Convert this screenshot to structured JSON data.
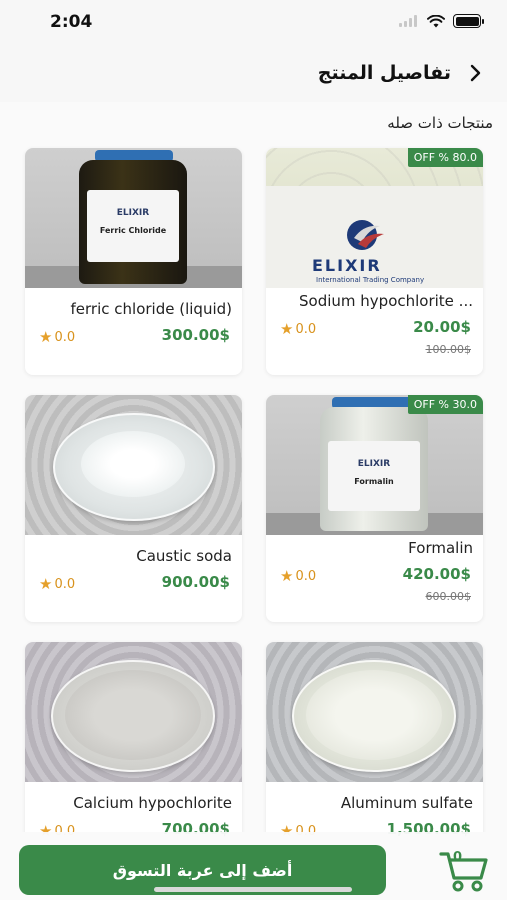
{
  "status_bar": {
    "time": "2:04"
  },
  "header": {
    "title": "تفاصيل المنتج"
  },
  "section": {
    "title": "منتجات ذات صله"
  },
  "products": [
    {
      "name": "ferric chloride (liquid)",
      "price": "300.00$",
      "rating": "0.0",
      "old_price": "",
      "discount": "",
      "image": "ferric-chloride-bottle",
      "label_brand": "ELIXIR",
      "label_text": "Ferric Chloride"
    },
    {
      "name": "Sodium hypochlorite ...",
      "price": "20.00$",
      "rating": "0.0",
      "old_price": "100.00$",
      "discount": "OFF % 80.0",
      "image": "sodium-hypochlorite-bottle",
      "label_brand": "ELIXIR",
      "label_sub": "International Trading Company"
    },
    {
      "name": "Caustic soda",
      "price": "900.00$",
      "rating": "0.0",
      "old_price": "",
      "discount": "",
      "image": "caustic-soda-petri"
    },
    {
      "name": "Formalin",
      "price": "420.00$",
      "rating": "0.0",
      "old_price": "600.00$",
      "discount": "OFF % 30.0",
      "image": "formalin-bottle",
      "label_brand": "ELIXIR",
      "label_text": "Formalin"
    },
    {
      "name": "Calcium hypochlorite",
      "price": "700.00$",
      "rating": "0.0",
      "old_price": "",
      "discount": "",
      "image": "calcium-hypochlorite-petri"
    },
    {
      "name": "Aluminum sulfate",
      "price": "1,500.00$",
      "rating": "0.0",
      "old_price": "",
      "discount": "",
      "image": "aluminum-sulfate-petri"
    }
  ],
  "bottom": {
    "add_to_cart": "أضف إلى عربة التسوق",
    "cart_count": "0"
  },
  "icons": {
    "back": "chevron-left-icon",
    "cart": "cart-icon",
    "star": "star-icon"
  },
  "colors": {
    "accent": "#3a8a49",
    "star": "#e5a02b"
  }
}
